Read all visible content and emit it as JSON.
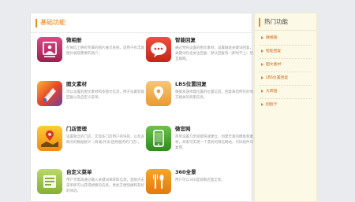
{
  "main": {
    "title": "基础功能",
    "features": [
      {
        "title": "微相册",
        "desc": "在微信上拥有专属的图片展示系统，适用于有丰富图片展现需要的商户。",
        "icon": "photo-album-icon",
        "color": "#c2336a"
      },
      {
        "title": "智能回复",
        "desc": "通过预先设置的图文素材，设置触发关键词回复，关键词包含关注回复、默认回复等（即时不上）及互联网。",
        "icon": "chat-bubble-icon",
        "color": "#e0362b"
      },
      {
        "title": "图文素材",
        "desc": "可以设置的图文素材和多图文信息，用于设置智能回复以及自定义菜单。",
        "icon": "material-icon",
        "color": "#e8442a"
      },
      {
        "title": "LBS位置回复",
        "desc": "根据发送地理位置的位置信息，回复离您所在的地方相关的商家信息。",
        "icon": "location-pin-icon",
        "color": "#f0a646"
      },
      {
        "title": "门店管理",
        "desc": "设置独立的门店，实现多门店用户的导航，以及多网点的数据统计（商城/外卖/团购服务的门店）。",
        "icon": "store-map-icon",
        "color": "#f5a623"
      },
      {
        "title": "微官网",
        "desc": "简单设置几步就能快速建立，创建丰富的模板和素材，商家可实现一个漂亮的微信网站，代码组件可复用。",
        "icon": "mobile-site-icon",
        "color": "#4aa32c"
      },
      {
        "title": "自定义菜单",
        "desc": "用户无需再通过输入关键词来获取信息，直接点击菜单即可以获得想要的信息，更加方便快捷和友好的体验。",
        "icon": "custom-menu-icon",
        "color": "#9cc445"
      },
      {
        "title": "360全景",
        "desc": "用户可以360度观看店面全景。",
        "icon": "panorama-icon",
        "color": "#ee8a12"
      }
    ]
  },
  "side": {
    "title": "热门功能",
    "items": [
      "微相册",
      "智能回复",
      "图文素材",
      "LBS位置回复",
      "大转盘",
      "刮刮卡"
    ]
  }
}
